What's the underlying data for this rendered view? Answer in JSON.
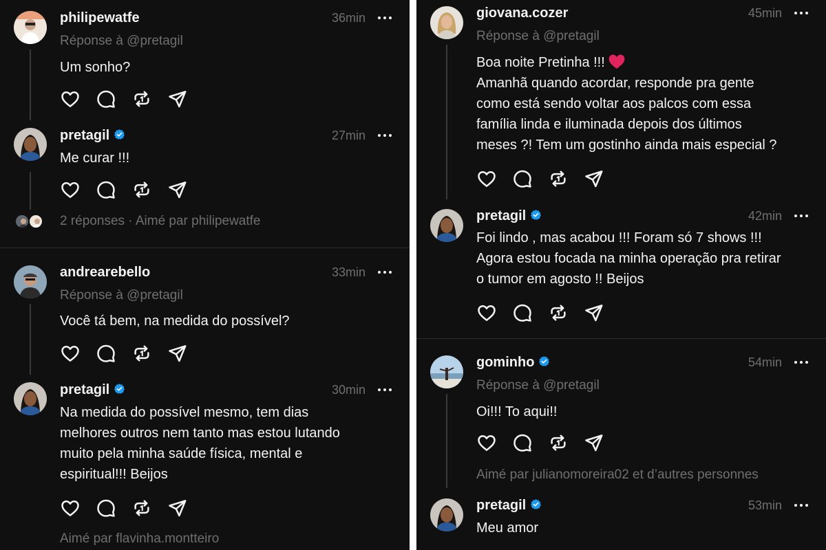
{
  "left": {
    "posts": [
      {
        "username": "philipewatfe",
        "time": "36min",
        "reply_to": "Réponse à @pretagil",
        "lines": [
          "Um sonho?"
        ]
      },
      {
        "username": "pretagil",
        "time": "27min",
        "lines": [
          "Me curar !!!"
        ],
        "meta": "2 réponses · Aimé par philipewatfe"
      },
      {
        "username": "andrearebello",
        "time": "33min",
        "reply_to": "Réponse à @pretagil",
        "lines": [
          "Você tá bem, na medida do possível?"
        ]
      },
      {
        "username": "pretagil",
        "time": "30min",
        "lines": [
          "Na medida do possível mesmo, tem dias",
          "melhores outros nem tanto mas estou lutando",
          "muito pela minha saúde física, mental e",
          "espiritual!!! Beijos"
        ],
        "meta": "Aimé par flavinha.montteiro"
      }
    ]
  },
  "right": {
    "posts": [
      {
        "username": "giovana.cozer",
        "time": "45min",
        "reply_to": "Réponse à @pretagil",
        "lines": [
          "Boa noite Pretinha !!!",
          "Amanhã quando acordar, responde pra gente",
          "como está sendo voltar aos palcos com essa",
          "família linda e iluminada depois dos últimos",
          "meses ?! Tem um gostinho ainda mais especial ?"
        ]
      },
      {
        "username": "pretagil",
        "time": "42min",
        "lines": [
          "Foi lindo , mas acabou !!! Foram só 7 shows !!!",
          "Agora estou focada na minha operação pra retirar",
          "o tumor em agosto !! Beijos"
        ]
      },
      {
        "username": "gominho",
        "time": "54min",
        "reply_to": "Réponse à @pretagil",
        "lines": [
          "Oi!!! To aqui!!"
        ],
        "meta": "Aimé par julianomoreira02 et d’autres personnes"
      },
      {
        "username": "pretagil",
        "time": "53min",
        "lines": [
          "Meu amor"
        ]
      }
    ]
  },
  "icons": {
    "like": "heart-outline-icon",
    "comment": "speech-bubble-icon",
    "repost": "repost-arrows-icon",
    "share": "send-paper-plane-icon",
    "more": "more-horizontal-icon",
    "verified": "verified-badge-icon",
    "emoji": "red-heart-emoji"
  },
  "colors": {
    "background": "#101010",
    "text": "#f3f3f3",
    "muted": "#6f6f6f",
    "verified": "#1d9bf0",
    "heart_emoji": "#e0245e"
  }
}
